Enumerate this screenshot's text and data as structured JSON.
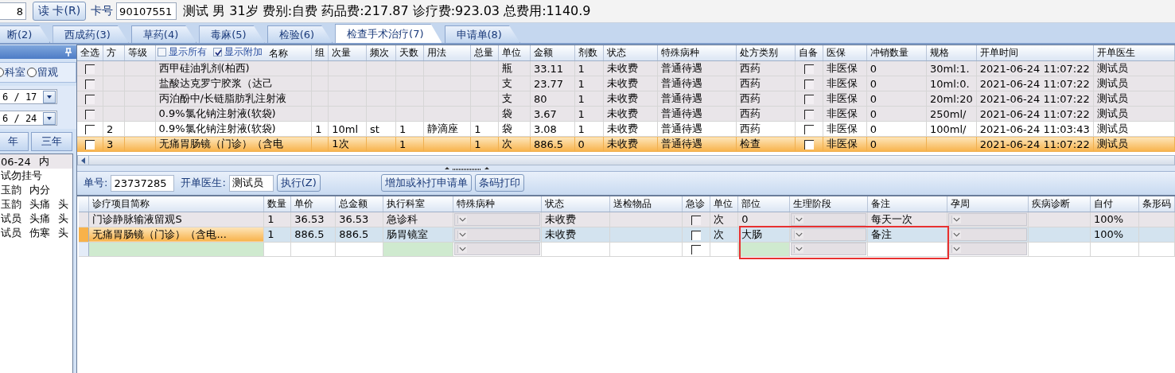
{
  "top_bar": {
    "id_field": "8",
    "read_card_button": "读 卡(R)",
    "card_label": "卡号",
    "card_number": "90107551",
    "patient_summary": "测试 男 31岁 费别:自费 药品费:217.87 诊疗费:923.03 总费用:1140.9"
  },
  "tabs": [
    {
      "label": "断(2)",
      "selected": false
    },
    {
      "label": "西成药(3)",
      "selected": false
    },
    {
      "label": "草药(4)",
      "selected": false
    },
    {
      "label": "毒麻(5)",
      "selected": false
    },
    {
      "label": "检验(6)",
      "selected": false
    },
    {
      "label": "检查手术治疗(7)",
      "selected": true
    },
    {
      "label": "申请单(8)",
      "selected": false
    }
  ],
  "side_panel": {
    "radios": [
      {
        "label": "科室",
        "selected": false
      },
      {
        "label": "留观",
        "selected": false
      }
    ],
    "start_date": "6 / 17",
    "end_date": "6 / 24",
    "range_buttons": [
      "年",
      "三年"
    ],
    "visits": [
      {
        "cells": [
          "06-24",
          "内"
        ],
        "selected": true
      },
      {
        "cells": [
          "试勿挂号"
        ],
        "selected": false
      },
      {
        "cells": [
          "玉韵",
          "内分"
        ],
        "selected": false
      },
      {
        "cells": [
          "玉韵",
          "头痛",
          "头"
        ],
        "selected": false
      },
      {
        "cells": [
          "试员",
          "头痛",
          "头"
        ],
        "selected": false
      },
      {
        "cells": [
          "试员",
          "伤寒",
          "头"
        ],
        "selected": false
      }
    ]
  },
  "upper_grid": {
    "columns": [
      {
        "label": "全选",
        "kind": "check"
      },
      {
        "label": "方",
        "kind": "text"
      },
      {
        "label": "等级",
        "kind": "text"
      },
      {
        "label": "名称",
        "kind": "text",
        "options": [
          {
            "label": "显示所有",
            "checked": false
          },
          {
            "label": "显示附加",
            "checked": true
          }
        ]
      },
      {
        "label": "组",
        "kind": "text"
      },
      {
        "label": "次量",
        "kind": "text"
      },
      {
        "label": "频次",
        "kind": "text"
      },
      {
        "label": "天数",
        "kind": "text"
      },
      {
        "label": "用法",
        "kind": "text"
      },
      {
        "label": "总量",
        "kind": "text"
      },
      {
        "label": "单位",
        "kind": "text"
      },
      {
        "label": "金额",
        "kind": "text"
      },
      {
        "label": "剂数",
        "kind": "text"
      },
      {
        "label": "状态",
        "kind": "text"
      },
      {
        "label": "特殊病种",
        "kind": "text"
      },
      {
        "label": "处方类别",
        "kind": "text"
      },
      {
        "label": "自备",
        "kind": "check"
      },
      {
        "label": "医保",
        "kind": "text"
      },
      {
        "label": "冲销数量",
        "kind": "text"
      },
      {
        "label": "规格",
        "kind": "text"
      },
      {
        "label": "开单时间",
        "kind": "text"
      },
      {
        "label": "开单医生",
        "kind": "text"
      }
    ],
    "rows": [
      {
        "shaded": true,
        "selected": false,
        "cells": [
          false,
          null,
          null,
          "西甲硅油乳剂(柏西)",
          null,
          null,
          null,
          null,
          null,
          null,
          "瓶",
          "33.11",
          "1",
          "未收费",
          "普通待遇",
          "西药",
          false,
          "非医保",
          "0",
          "30ml:1.",
          "2021-06-24 11:07:22",
          "测试员"
        ]
      },
      {
        "shaded": true,
        "selected": false,
        "cells": [
          false,
          null,
          null,
          "盐酸达克罗宁胶浆（达己",
          null,
          null,
          null,
          null,
          null,
          null,
          "支",
          "23.77",
          "1",
          "未收费",
          "普通待遇",
          "西药",
          false,
          "非医保",
          "0",
          "10ml:0.",
          "2021-06-24 11:07:22",
          "测试员"
        ]
      },
      {
        "shaded": true,
        "selected": false,
        "cells": [
          false,
          null,
          null,
          "丙泊酚中/长链脂肪乳注射液",
          null,
          null,
          null,
          null,
          null,
          null,
          "支",
          "80",
          "1",
          "未收费",
          "普通待遇",
          "西药",
          false,
          "非医保",
          "0",
          "20ml:20",
          "2021-06-24 11:07:22",
          "测试员"
        ]
      },
      {
        "shaded": true,
        "selected": false,
        "cells": [
          false,
          null,
          null,
          "0.9%氯化钠注射液(软袋)",
          null,
          null,
          null,
          null,
          null,
          null,
          "袋",
          "3.67",
          "1",
          "未收费",
          "普通待遇",
          "西药",
          false,
          "非医保",
          "0",
          "250ml/",
          "2021-06-24 11:07:22",
          "测试员"
        ]
      },
      {
        "shaded": false,
        "selected": false,
        "cells": [
          false,
          "2",
          null,
          "0.9%氯化钠注射液(软袋)",
          "1",
          "10ml",
          "st",
          "1",
          "静滴座",
          "1",
          "袋",
          "3.08",
          "1",
          "未收费",
          "普通待遇",
          "西药",
          false,
          "非医保",
          "0",
          "100ml/",
          "2021-06-24 11:03:43",
          "测试员"
        ]
      },
      {
        "shaded": false,
        "selected": true,
        "cells": [
          false,
          "3",
          null,
          "无痛胃肠镜（门诊）（含电",
          null,
          "1次",
          null,
          "1",
          null,
          "1",
          "次",
          "886.5",
          "0",
          "未收费",
          "普通待遇",
          "检查",
          false,
          "非医保",
          "0",
          null,
          "2021-06-24 11:07:22",
          "测试员"
        ]
      }
    ]
  },
  "order_toolbar": {
    "order_label": "单号:",
    "order_number": "23737285",
    "doctor_label": "开单医生:",
    "doctor": "测试员",
    "buttons": [
      {
        "label": "执行(Z)"
      },
      {
        "label": "增加或补打申请单"
      },
      {
        "label": "条码打印"
      }
    ]
  },
  "lower_grid": {
    "columns": [
      {
        "label": "诊疗项目简称",
        "kind": "text",
        "required": true
      },
      {
        "label": "数量",
        "kind": "text",
        "required": false
      },
      {
        "label": "单价",
        "kind": "text",
        "required": false
      },
      {
        "label": "总金额",
        "kind": "text",
        "required": false
      },
      {
        "label": "执行科室",
        "kind": "text",
        "required": true
      },
      {
        "label": "特殊病种",
        "kind": "dropdown",
        "required": false
      },
      {
        "label": "状态",
        "kind": "text",
        "required": false
      },
      {
        "label": "送检物品",
        "kind": "text",
        "required": false
      },
      {
        "label": "急诊",
        "kind": "check",
        "required": false
      },
      {
        "label": "单位",
        "kind": "text",
        "required": false
      },
      {
        "label": "部位",
        "kind": "text",
        "required": true
      },
      {
        "label": "生理阶段",
        "kind": "dropdown",
        "required": false
      },
      {
        "label": "备注",
        "kind": "text",
        "required": false
      },
      {
        "label": "孕周",
        "kind": "dropdown",
        "required": false
      },
      {
        "label": "疾病诊断",
        "kind": "text",
        "required": false
      },
      {
        "label": "自付",
        "kind": "text",
        "required": false
      },
      {
        "label": "条形码",
        "kind": "text",
        "required": false
      }
    ],
    "rows": [
      {
        "shaded": true,
        "selected": false,
        "new": false,
        "cells": [
          "门诊静脉输液留观S",
          "1",
          "36.53",
          "36.53",
          "急诊科",
          null,
          "未收费",
          null,
          false,
          "次",
          "0",
          null,
          "每天一次",
          null,
          null,
          "100%",
          null
        ]
      },
      {
        "shaded": false,
        "selected": true,
        "new": false,
        "cells": [
          "无痛胃肠镜（门诊）（含电...",
          "1",
          "886.5",
          "886.5",
          "肠胃镜室",
          null,
          "未收费",
          null,
          false,
          "次",
          "大肠",
          null,
          "备注",
          null,
          null,
          "100%",
          null
        ]
      },
      {
        "shaded": false,
        "selected": false,
        "new": true,
        "cells": [
          null,
          null,
          null,
          null,
          null,
          null,
          null,
          null,
          false,
          null,
          null,
          null,
          null,
          null,
          null,
          null,
          null
        ]
      }
    ]
  }
}
